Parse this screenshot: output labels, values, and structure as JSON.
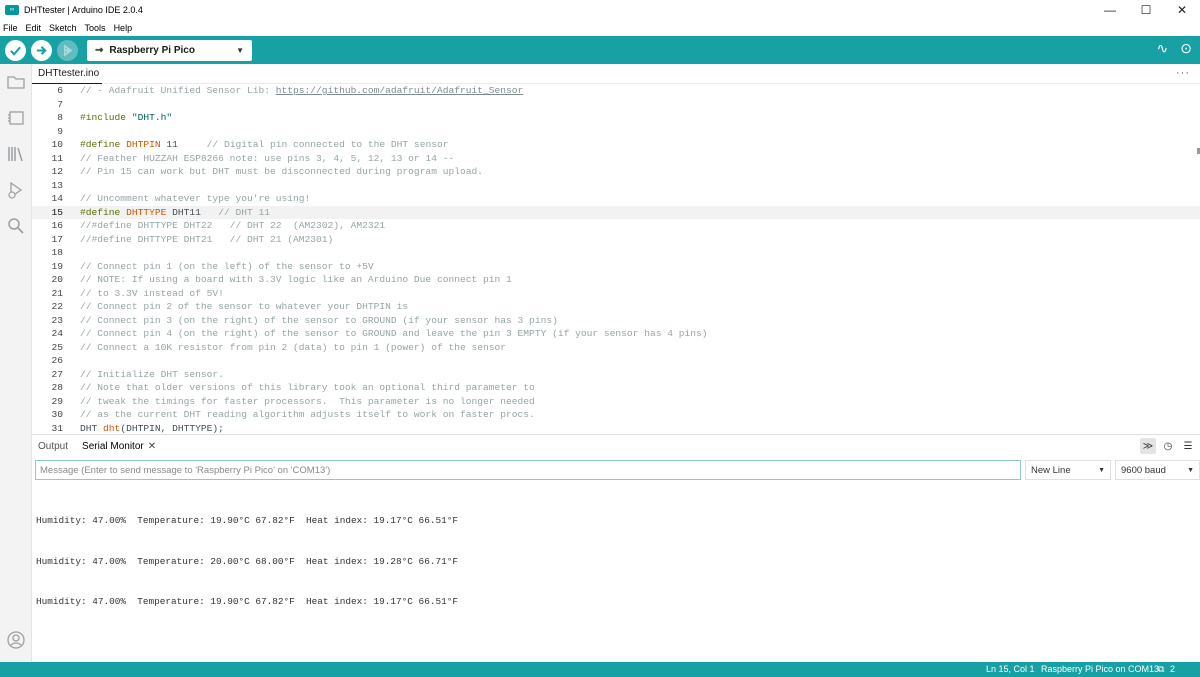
{
  "window": {
    "title": "DHTtester | Arduino IDE 2.0.4",
    "icon_text": "∞",
    "controls": {
      "minimize": "—",
      "maximize": "☐",
      "close": "✕"
    }
  },
  "menu": [
    "File",
    "Edit",
    "Sketch",
    "Tools",
    "Help"
  ],
  "toolbar": {
    "board": "Raspberry Pi Pico",
    "usb_glyph": "⇝",
    "chevron": "▼",
    "plotter_glyph": "∿",
    "monitor_glyph": "⊙"
  },
  "tab": {
    "filename": "DHTtester.ino",
    "more": "···"
  },
  "editor": {
    "current_line": "15",
    "lines": [
      {
        "n": "6",
        "parts": [
          {
            "t": "// - Adafruit Unified Sensor Lib: ",
            "c": "c-comment"
          },
          {
            "t": "https://github.com/adafruit/Adafruit_Sensor",
            "c": "c-link"
          }
        ]
      },
      {
        "n": "7",
        "parts": []
      },
      {
        "n": "8",
        "parts": [
          {
            "t": "#include ",
            "c": "c-dir"
          },
          {
            "t": "\"DHT.h\"",
            "c": "c-str"
          }
        ]
      },
      {
        "n": "9",
        "parts": []
      },
      {
        "n": "10",
        "parts": [
          {
            "t": "#define ",
            "c": "c-dir"
          },
          {
            "t": "DHTPIN",
            "c": "c-kw"
          },
          {
            "t": " 11     ",
            "c": ""
          },
          {
            "t": "// Digital pin connected to the DHT sensor",
            "c": "c-comment"
          }
        ]
      },
      {
        "n": "11",
        "parts": [
          {
            "t": "// Feather HUZZAH ESP8266 note: use pins 3, 4, 5, 12, 13 or 14 --",
            "c": "c-comment"
          }
        ]
      },
      {
        "n": "12",
        "parts": [
          {
            "t": "// Pin 15 can work but DHT must be disconnected during program upload.",
            "c": "c-comment"
          }
        ]
      },
      {
        "n": "13",
        "parts": []
      },
      {
        "n": "14",
        "parts": [
          {
            "t": "// Uncomment whatever type you're using!",
            "c": "c-comment"
          }
        ]
      },
      {
        "n": "15",
        "parts": [
          {
            "t": "#define ",
            "c": "c-dir"
          },
          {
            "t": "DHTTYPE",
            "c": "c-kw"
          },
          {
            "t": " DHT11   ",
            "c": ""
          },
          {
            "t": "// DHT 11",
            "c": "c-comment"
          }
        ]
      },
      {
        "n": "16",
        "parts": [
          {
            "t": "//#define DHTTYPE DHT22   // DHT 22  (AM2302), AM2321",
            "c": "c-comment"
          }
        ]
      },
      {
        "n": "17",
        "parts": [
          {
            "t": "//#define DHTTYPE DHT21   // DHT 21 (AM2301)",
            "c": "c-comment"
          }
        ]
      },
      {
        "n": "18",
        "parts": []
      },
      {
        "n": "19",
        "parts": [
          {
            "t": "// Connect pin 1 (on the left) of the sensor to +5V",
            "c": "c-comment"
          }
        ]
      },
      {
        "n": "20",
        "parts": [
          {
            "t": "// NOTE: If using a board with 3.3V logic like an Arduino Due connect pin 1",
            "c": "c-comment"
          }
        ]
      },
      {
        "n": "21",
        "parts": [
          {
            "t": "// to 3.3V instead of 5V!",
            "c": "c-comment"
          }
        ]
      },
      {
        "n": "22",
        "parts": [
          {
            "t": "// Connect pin 2 of the sensor to whatever your DHTPIN is",
            "c": "c-comment"
          }
        ]
      },
      {
        "n": "23",
        "parts": [
          {
            "t": "// Connect pin 3 (on the right) of the sensor to GROUND (if your sensor has 3 pins)",
            "c": "c-comment"
          }
        ]
      },
      {
        "n": "24",
        "parts": [
          {
            "t": "// Connect pin 4 (on the right) of the sensor to GROUND and leave the pin 3 EMPTY (if your sensor has 4 pins)",
            "c": "c-comment"
          }
        ]
      },
      {
        "n": "25",
        "parts": [
          {
            "t": "// Connect a 10K resistor from pin 2 (data) to pin 1 (power) of the sensor",
            "c": "c-comment"
          }
        ]
      },
      {
        "n": "26",
        "parts": []
      },
      {
        "n": "27",
        "parts": [
          {
            "t": "// Initialize DHT sensor.",
            "c": "c-comment"
          }
        ]
      },
      {
        "n": "28",
        "parts": [
          {
            "t": "// Note that older versions of this library took an optional third parameter to",
            "c": "c-comment"
          }
        ]
      },
      {
        "n": "29",
        "parts": [
          {
            "t": "// tweak the timings for faster processors.  This parameter is no longer needed",
            "c": "c-comment"
          }
        ]
      },
      {
        "n": "30",
        "parts": [
          {
            "t": "// as the current DHT reading algorithm adjusts itself to work on faster procs.",
            "c": "c-comment"
          }
        ]
      },
      {
        "n": "31",
        "parts": [
          {
            "t": "DHT ",
            "c": ""
          },
          {
            "t": "dht",
            "c": "c-fn"
          },
          {
            "t": "(DHTPIN, DHTTYPE);",
            "c": ""
          }
        ]
      }
    ]
  },
  "panel": {
    "tabs": {
      "output": "Output",
      "serial": "Serial Monitor",
      "close": "✕"
    },
    "icons": {
      "toggle": "≫",
      "timestamp": "◷",
      "menu": "☰"
    },
    "message_placeholder": "Message (Enter to send message to 'Raspberry Pi Pico' on 'COM13')",
    "line_ending": "New Line",
    "baud": "9600 baud",
    "chevron": "▼",
    "output_lines": [
      "Humidity: 47.00%  Temperature: 19.90°C 67.82°F  Heat index: 19.17°C 66.51°F",
      "Humidity: 47.00%  Temperature: 20.00°C 68.00°F  Heat index: 19.28°C 66.71°F",
      "Humidity: 47.00%  Temperature: 19.90°C 67.82°F  Heat index: 19.17°C 66.51°F"
    ]
  },
  "status": {
    "cursor": "Ln 15, Col 1",
    "board_port": "Raspberry Pi Pico on COM13",
    "notifications": "2",
    "notif_glyph": "⧉"
  },
  "colors": {
    "accent": "#17a1a5",
    "comment": "#95a5a6",
    "keyword": "#d35400",
    "directive": "#5e6d03"
  }
}
